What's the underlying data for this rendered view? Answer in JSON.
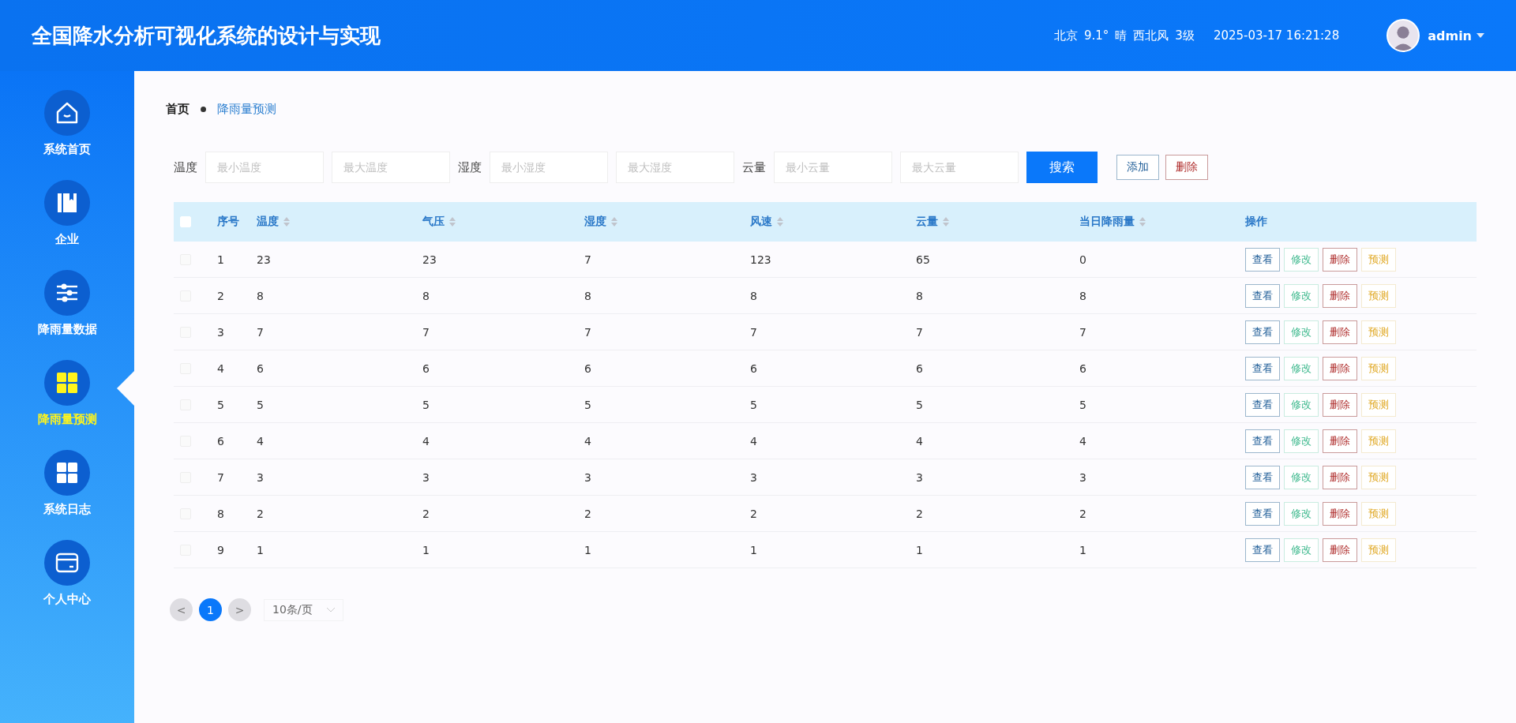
{
  "header": {
    "title": "全国降水分析可视化系统的设计与实现",
    "city": "北京",
    "temperature": "9.1°",
    "weather": "晴",
    "wind": "西北风",
    "wind_level": "3级",
    "datetime": "2025-03-17 16:21:28",
    "user": "admin"
  },
  "sidebar": {
    "items": [
      {
        "label": "系统首页",
        "selected": false
      },
      {
        "label": "企业",
        "selected": false
      },
      {
        "label": "降雨量数据",
        "selected": false
      },
      {
        "label": "降雨量预测",
        "selected": true
      },
      {
        "label": "系统日志",
        "selected": false
      },
      {
        "label": "个人中心",
        "selected": false
      }
    ]
  },
  "breadcrumb": [
    "首页",
    "降雨量预测"
  ],
  "filters": [
    {
      "label": "温度",
      "placeholders": [
        "最小温度",
        "最大温度"
      ]
    },
    {
      "label": "湿度",
      "placeholders": [
        "最小湿度",
        "最大湿度"
      ]
    },
    {
      "label": "云量",
      "placeholders": [
        "最小云量",
        "最大云量"
      ]
    }
  ],
  "search_button": "搜索",
  "actions": [
    {
      "label": "添加",
      "kind": "primary"
    },
    {
      "label": "删除",
      "kind": "danger"
    }
  ],
  "table": {
    "all_checked": false,
    "columns": [
      {
        "label": "序号",
        "sortable": false
      },
      {
        "label": "温度",
        "sortable": true
      },
      {
        "label": "气压",
        "sortable": true
      },
      {
        "label": "湿度",
        "sortable": true
      },
      {
        "label": "风速",
        "sortable": true
      },
      {
        "label": "云量",
        "sortable": true
      },
      {
        "label": "当日降雨量",
        "sortable": true
      },
      {
        "label": "操作",
        "sortable": false
      }
    ],
    "rows": [
      {
        "checked": false,
        "cells": [
          "1",
          "23",
          "23",
          "7",
          "123",
          "65",
          "0"
        ],
        "actions": [
          {
            "label": "查看",
            "kind": "primary"
          },
          {
            "label": "修改",
            "kind": "success"
          },
          {
            "label": "删除",
            "kind": "danger"
          },
          {
            "label": "预测",
            "kind": "warning"
          }
        ]
      },
      {
        "checked": false,
        "cells": [
          "2",
          "8",
          "8",
          "8",
          "8",
          "8",
          "8"
        ],
        "actions": [
          {
            "label": "查看",
            "kind": "primary"
          },
          {
            "label": "修改",
            "kind": "success"
          },
          {
            "label": "删除",
            "kind": "danger"
          },
          {
            "label": "预测",
            "kind": "warning"
          }
        ]
      },
      {
        "checked": false,
        "cells": [
          "3",
          "7",
          "7",
          "7",
          "7",
          "7",
          "7"
        ],
        "actions": [
          {
            "label": "查看",
            "kind": "primary"
          },
          {
            "label": "修改",
            "kind": "success"
          },
          {
            "label": "删除",
            "kind": "danger"
          },
          {
            "label": "预测",
            "kind": "warning"
          }
        ]
      },
      {
        "checked": false,
        "cells": [
          "4",
          "6",
          "6",
          "6",
          "6",
          "6",
          "6"
        ],
        "actions": [
          {
            "label": "查看",
            "kind": "primary"
          },
          {
            "label": "修改",
            "kind": "success"
          },
          {
            "label": "删除",
            "kind": "danger"
          },
          {
            "label": "预测",
            "kind": "warning"
          }
        ]
      },
      {
        "checked": false,
        "cells": [
          "5",
          "5",
          "5",
          "5",
          "5",
          "5",
          "5"
        ],
        "actions": [
          {
            "label": "查看",
            "kind": "primary"
          },
          {
            "label": "修改",
            "kind": "success"
          },
          {
            "label": "删除",
            "kind": "danger"
          },
          {
            "label": "预测",
            "kind": "warning"
          }
        ]
      },
      {
        "checked": false,
        "cells": [
          "6",
          "4",
          "4",
          "4",
          "4",
          "4",
          "4"
        ],
        "actions": [
          {
            "label": "查看",
            "kind": "primary"
          },
          {
            "label": "修改",
            "kind": "success"
          },
          {
            "label": "删除",
            "kind": "danger"
          },
          {
            "label": "预测",
            "kind": "warning"
          }
        ]
      },
      {
        "checked": false,
        "cells": [
          "7",
          "3",
          "3",
          "3",
          "3",
          "3",
          "3"
        ],
        "actions": [
          {
            "label": "查看",
            "kind": "primary"
          },
          {
            "label": "修改",
            "kind": "success"
          },
          {
            "label": "删除",
            "kind": "danger"
          },
          {
            "label": "预测",
            "kind": "warning"
          }
        ]
      },
      {
        "checked": false,
        "cells": [
          "8",
          "2",
          "2",
          "2",
          "2",
          "2",
          "2"
        ],
        "actions": [
          {
            "label": "查看",
            "kind": "primary"
          },
          {
            "label": "修改",
            "kind": "success"
          },
          {
            "label": "删除",
            "kind": "danger"
          },
          {
            "label": "预测",
            "kind": "warning"
          }
        ]
      },
      {
        "checked": false,
        "cells": [
          "9",
          "1",
          "1",
          "1",
          "1",
          "1",
          "1"
        ],
        "actions": [
          {
            "label": "查看",
            "kind": "primary"
          },
          {
            "label": "修改",
            "kind": "success"
          },
          {
            "label": "删除",
            "kind": "danger"
          },
          {
            "label": "预测",
            "kind": "warning"
          }
        ]
      }
    ]
  },
  "pagination": {
    "prev": "<",
    "pages": [
      {
        "label": "1",
        "selected": true
      }
    ],
    "next": ">",
    "page_size": "10条/页"
  }
}
